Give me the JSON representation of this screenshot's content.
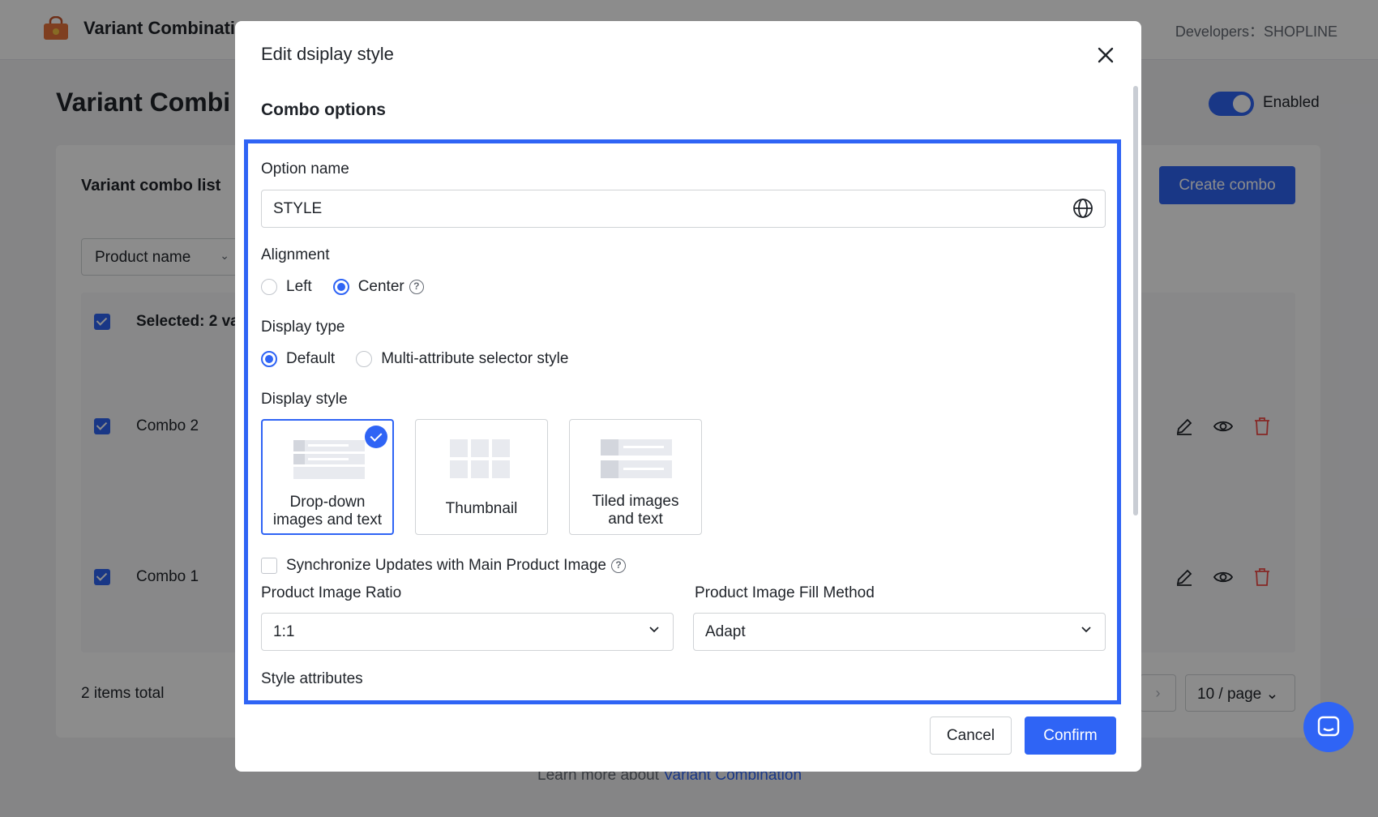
{
  "app": {
    "title": "Variant Combinati",
    "developer": "Developers：SHOPLINE"
  },
  "page": {
    "title": "Variant Combi",
    "enabled_label": "Enabled"
  },
  "card": {
    "title": "Variant combo list",
    "create_button": "Create combo",
    "filter_label": "Product name",
    "selected_text": "Selected: 2 va",
    "rows": [
      {
        "name": "Combo 2"
      },
      {
        "name": "Combo 1"
      }
    ],
    "total": "2 items total",
    "page_size": "10 / page"
  },
  "learn_more": {
    "prefix": "Learn more about",
    "link": "Variant Combination"
  },
  "modal": {
    "title": "Edit dsiplay style",
    "section_title": "Combo options",
    "option_name": {
      "label": "Option name",
      "value": "STYLE"
    },
    "alignment": {
      "label": "Alignment",
      "options": [
        "Left",
        "Center"
      ],
      "selected": "Center"
    },
    "display_type": {
      "label": "Display type",
      "options": [
        "Default",
        "Multi-attribute selector style"
      ],
      "selected": "Default"
    },
    "display_style": {
      "label": "Display style",
      "cards": [
        {
          "line1": "Drop-down",
          "line2": "images and text",
          "selected": true
        },
        {
          "line1": "Thumbnail",
          "line2": "",
          "selected": false
        },
        {
          "line1": "Tiled images",
          "line2": "and text",
          "selected": false
        }
      ]
    },
    "sync_checkbox": {
      "label": "Synchronize Updates with Main Product Image",
      "checked": false
    },
    "image_ratio": {
      "label": "Product Image Ratio",
      "value": "1:1"
    },
    "fill_method": {
      "label": "Product Image Fill Method",
      "value": "Adapt"
    },
    "style_attributes_label": "Style attributes",
    "cancel": "Cancel",
    "confirm": "Confirm"
  },
  "colors": {
    "accent": "#2f64f5",
    "danger": "#f54a45"
  }
}
